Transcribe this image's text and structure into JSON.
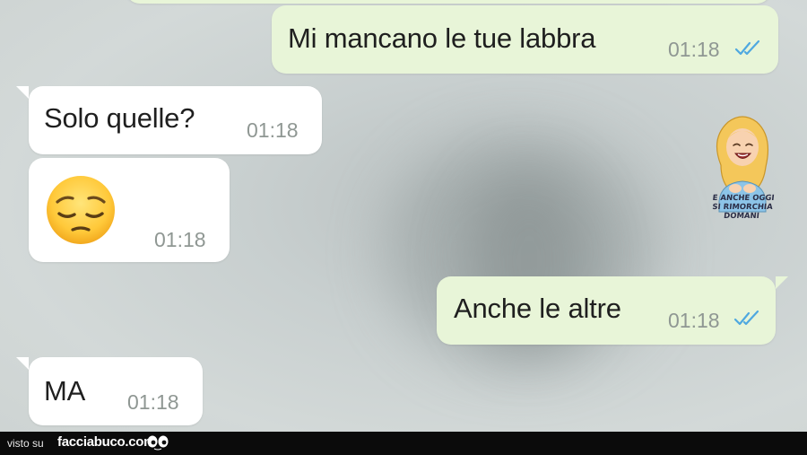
{
  "conversation": {
    "messages": [
      {
        "direction": "outgoing",
        "text": "Mi mancano le tue labbra",
        "time": "01:18",
        "status": "read"
      },
      {
        "direction": "incoming",
        "text": "Solo quelle?",
        "time": "01:18"
      },
      {
        "direction": "incoming",
        "emoji": "pensive-face",
        "time": "01:18"
      },
      {
        "direction": "outgoing",
        "text": "Anche le altre",
        "time": "01:18",
        "status": "read"
      },
      {
        "direction": "incoming",
        "text": "MA",
        "time": "01:18"
      }
    ]
  },
  "sticker": {
    "caption_line1": "E anche oggi",
    "caption_line2": "si rimorchia domani"
  },
  "footer": {
    "prefix": "visto su",
    "brand": "facciabuco.com"
  },
  "colors": {
    "incoming_bubble": "#ffffff",
    "outgoing_bubble": "#e8f5d8",
    "read_ticks": "#4fa8e0",
    "timestamp": "#8f9793",
    "footer_bg": "#0b0b0b"
  }
}
